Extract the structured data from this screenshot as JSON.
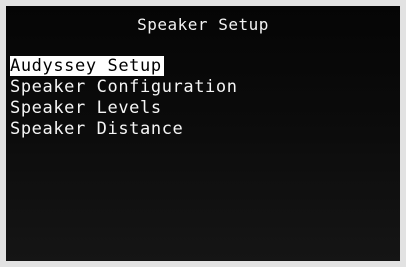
{
  "header": {
    "title": "Speaker Setup"
  },
  "menu": {
    "items": [
      {
        "label": "Audyssey Setup",
        "selected": true
      },
      {
        "label": "Speaker Configuration",
        "selected": false
      },
      {
        "label": "Speaker Levels",
        "selected": false
      },
      {
        "label": "Speaker Distance",
        "selected": false
      }
    ]
  },
  "colors": {
    "background": "#0b0b0b",
    "text": "#ffffff",
    "highlight_bg": "#ffffff",
    "highlight_text": "#000000"
  }
}
